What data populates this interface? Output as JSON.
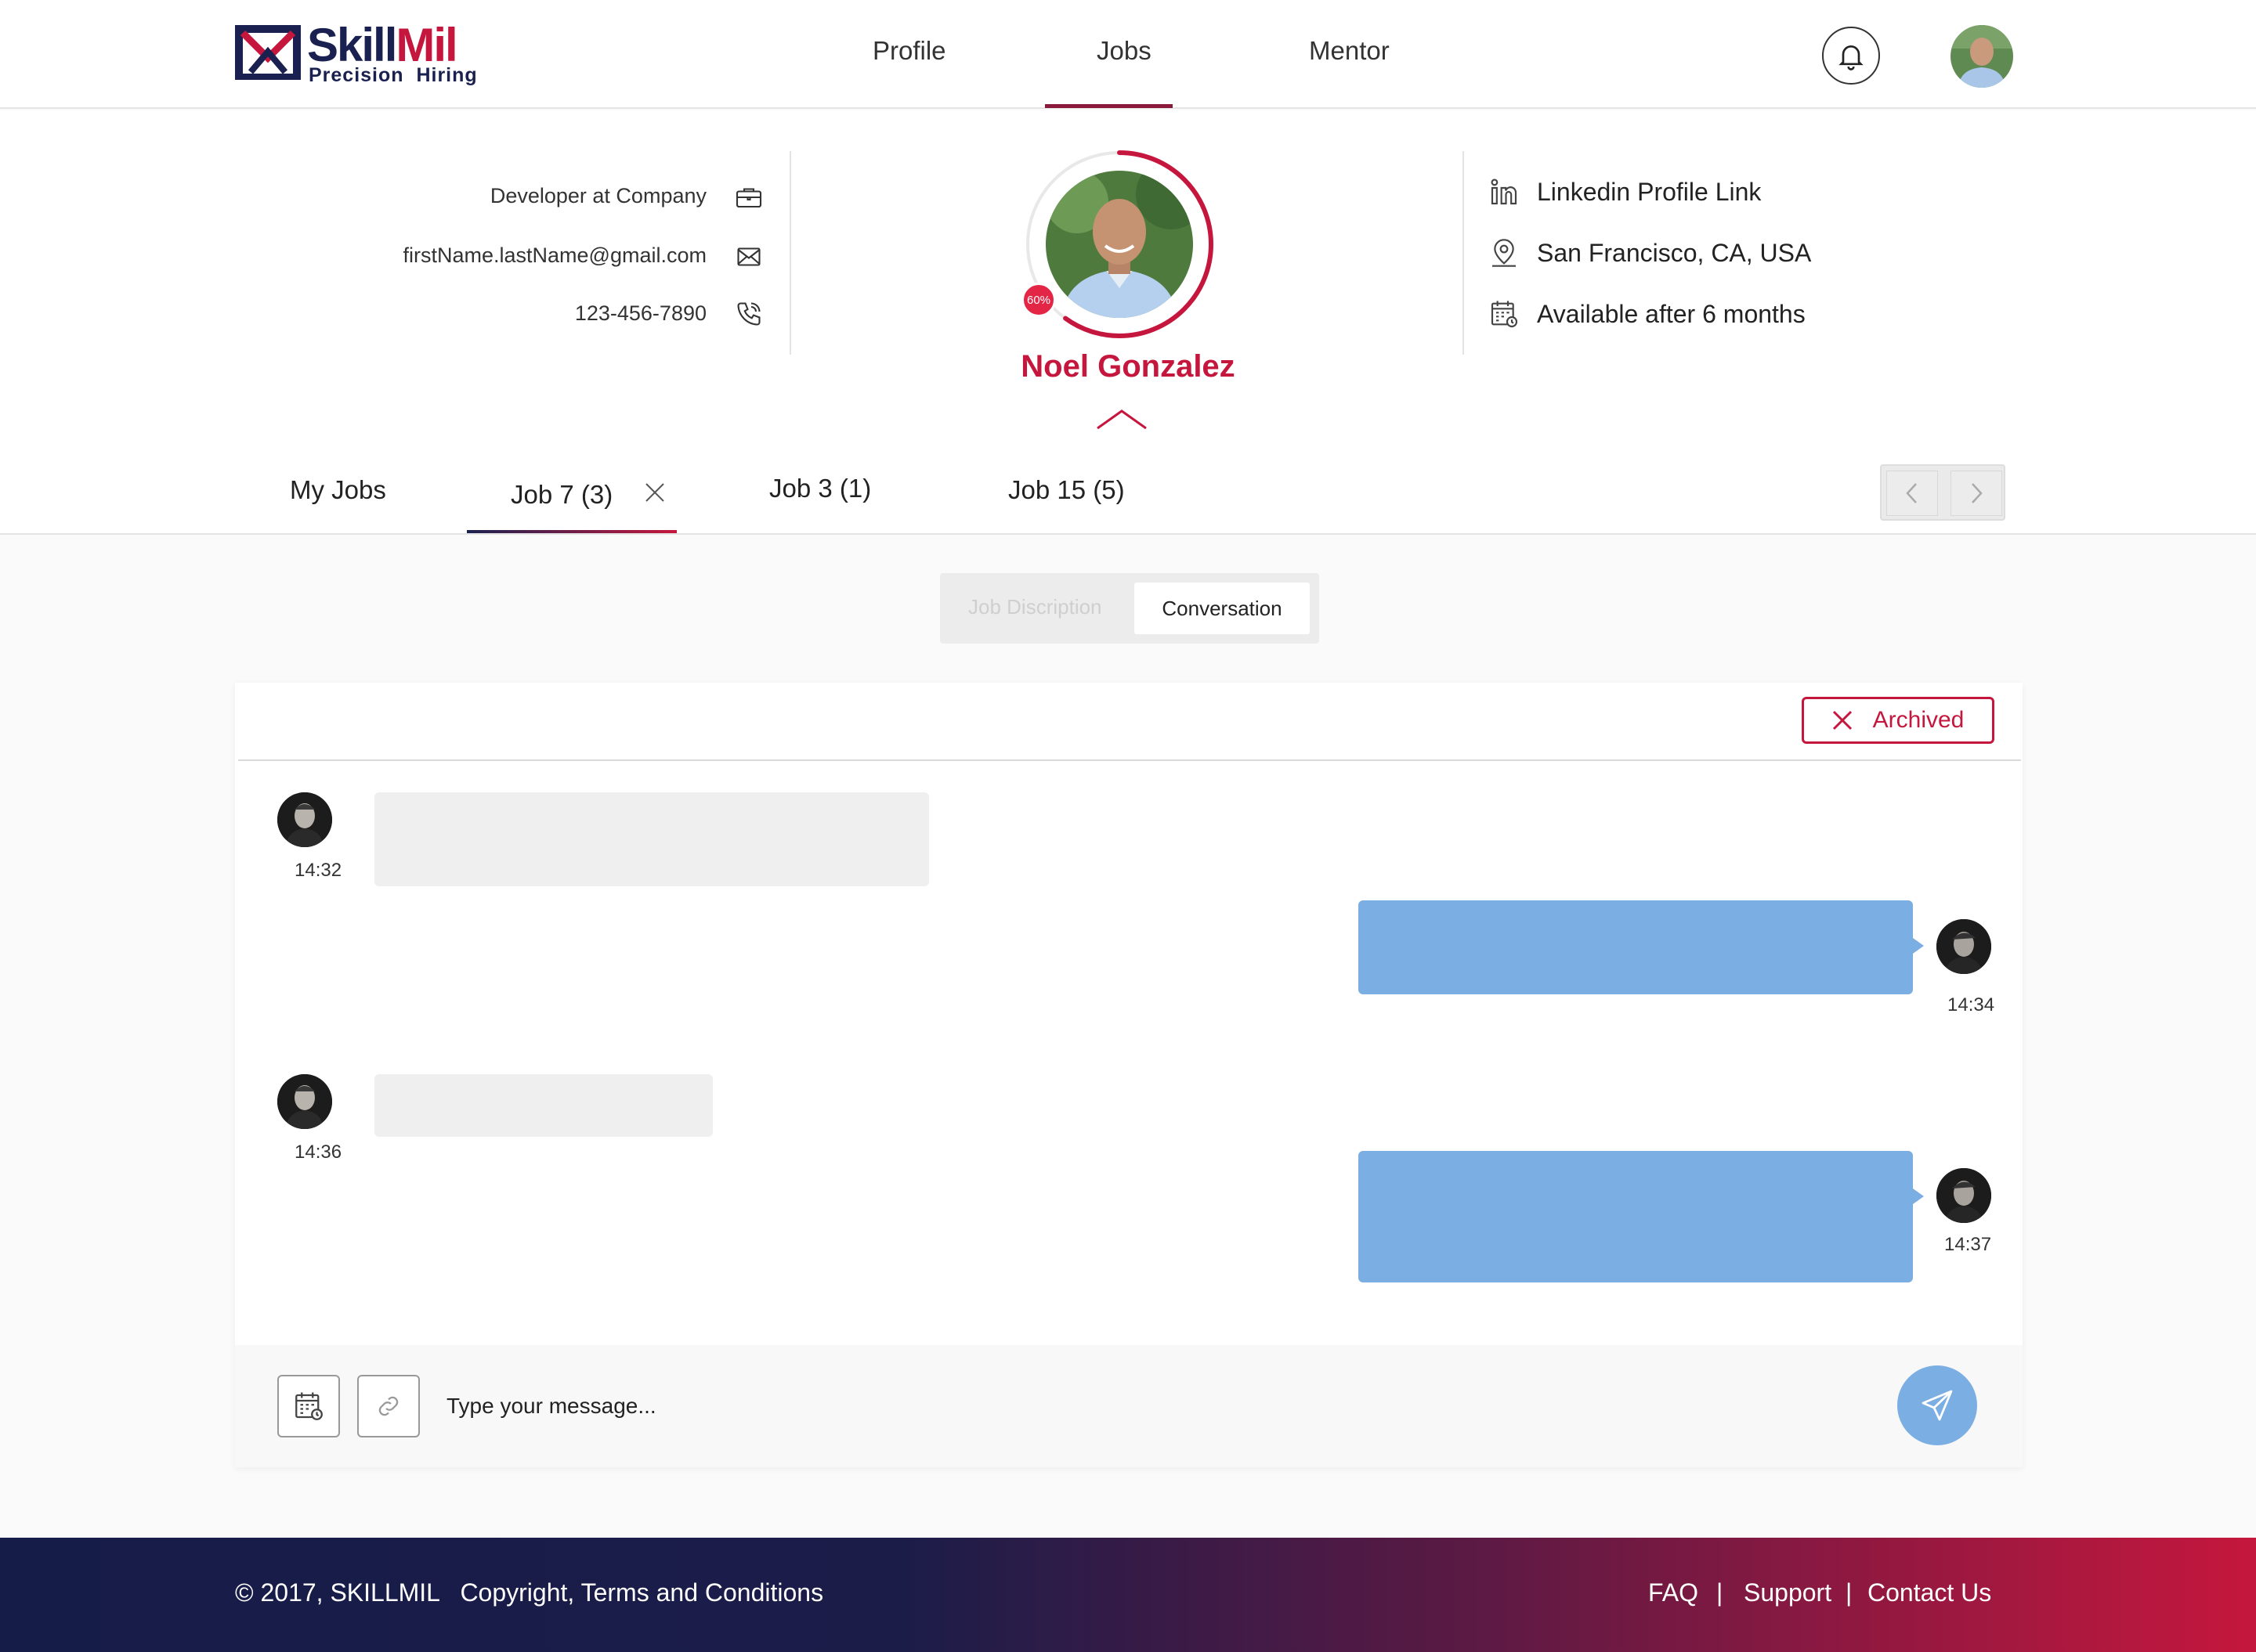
{
  "brand": {
    "name_part1": "Skill",
    "name_part2": "Mil",
    "tagline": "Precision  Hiring",
    "colors": {
      "navy": "#1a2150",
      "crimson": "#c5173d",
      "bubble_blue": "#7baee3"
    }
  },
  "nav": {
    "items": [
      {
        "label": "Profile"
      },
      {
        "label": "Jobs",
        "active": true
      },
      {
        "label": "Mentor"
      }
    ],
    "icons": {
      "bell": "bell-icon",
      "avatar": "user-avatar"
    }
  },
  "profile": {
    "name": "Noel Gonzalez",
    "completion_badge": "60%",
    "completion_fraction": 0.6,
    "contacts": [
      {
        "text": "Developer at Company",
        "icon": "briefcase-icon"
      },
      {
        "text": "firstName.lastName@gmail.com",
        "icon": "mail-icon"
      },
      {
        "text": "123-456-7890",
        "icon": "phone-icon"
      }
    ],
    "details": [
      {
        "text": "Linkedin Profile Link",
        "icon": "linkedin-icon"
      },
      {
        "text": "San Francisco, CA, USA",
        "icon": "location-icon"
      },
      {
        "text": "Available after 6 months",
        "icon": "calendar-icon"
      }
    ]
  },
  "tabs": {
    "items": [
      {
        "label": "My Jobs"
      },
      {
        "label": "Job 7 (3)",
        "active": true,
        "closable": true
      },
      {
        "label": "Job 3 (1)"
      },
      {
        "label": "Job 15 (5)"
      }
    ]
  },
  "segment": {
    "options": [
      "Job Discription",
      "Conversation"
    ],
    "selected": "Conversation"
  },
  "conversation": {
    "status_button": "Archived",
    "messages": [
      {
        "direction": "incoming",
        "time": "14:32"
      },
      {
        "direction": "outgoing",
        "time": "14:34"
      },
      {
        "direction": "incoming",
        "time": "14:36"
      },
      {
        "direction": "outgoing",
        "time": "14:37"
      }
    ],
    "composer": {
      "placeholder": "Type your message...",
      "icons": [
        "calendar-icon",
        "link-icon",
        "send-icon"
      ]
    }
  },
  "footer": {
    "copyright": "© 2017, SKILLMIL   Copyright, Terms and Conditions",
    "links": [
      "FAQ",
      "Support",
      "Contact Us"
    ],
    "separator": "|"
  }
}
